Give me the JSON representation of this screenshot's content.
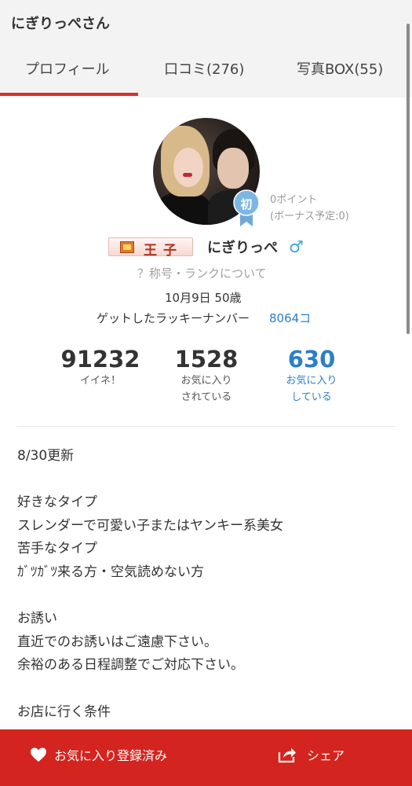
{
  "header": {
    "title": "にぎりっぺさん"
  },
  "tabs": [
    {
      "label": "プロフィール",
      "active": true
    },
    {
      "label": "口コミ(276)",
      "active": false
    },
    {
      "label": "写真BOX(55)",
      "active": false
    }
  ],
  "profile": {
    "first_badge": "初",
    "points": "0ポイント",
    "bonus_scheduled": "(ボーナス予定:0)",
    "rank_title": "王子",
    "username": "にぎりっぺ",
    "gender_symbol": "♂",
    "title_rank_link": "？称号・ランクについて",
    "birthday_age": "10月9日 50歳",
    "lucky_number_label": "ゲットしたラッキーナンバー",
    "lucky_number": "8064コ"
  },
  "stats": [
    {
      "value": "91232",
      "label_line1": "イイネ！",
      "label_line2": ""
    },
    {
      "value": "1528",
      "label_line1": "お気に入り",
      "label_line2": "されている"
    },
    {
      "value": "630",
      "label_line1": "お気に入り",
      "label_line2": "している"
    }
  ],
  "bio": {
    "lines": [
      "8/30更新",
      "",
      "好きなタイプ",
      "スレンダーで可愛い子またはヤンキー系美女",
      "苦手なタイプ",
      "ｶﾞﾂｶﾞﾂ来る方・空気読めない方",
      "",
      "お誘い",
      "直近でのお誘いはご遠慮下さい。",
      "余裕のある日程調整でご対応下さい。",
      "",
      "お店に行く条件"
    ]
  },
  "bottom_bar": {
    "favorite_label": "お気に入り登録済み",
    "share_label": "シェア"
  },
  "colors": {
    "accent_red": "#d3241f",
    "link_blue": "#2c7fc7",
    "gender_blue": "#39a9db"
  },
  "icons": {
    "favorite": "heart-icon",
    "share": "share-icon",
    "gender": "male-icon",
    "rank": "crown-icon"
  }
}
